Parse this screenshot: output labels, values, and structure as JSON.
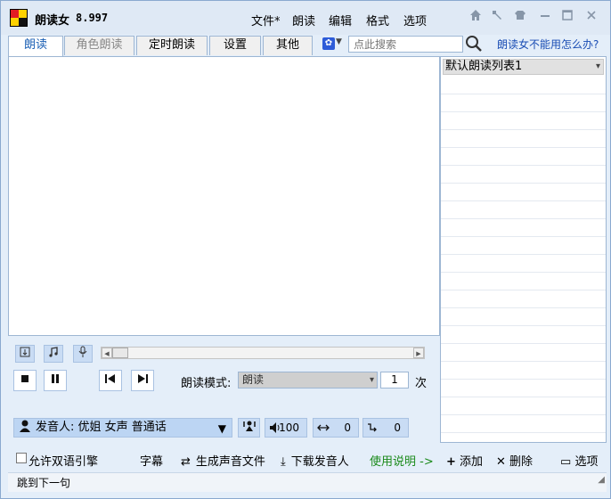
{
  "app": {
    "title": "朗读女",
    "version": "8.997"
  },
  "menu": [
    "文件*",
    "朗读",
    "编辑",
    "格式",
    "选项"
  ],
  "tabs": [
    {
      "label": "朗读",
      "active": true
    },
    {
      "label": "角色朗读",
      "disabled": true
    },
    {
      "label": "定时朗读"
    },
    {
      "label": "设置"
    },
    {
      "label": "其他"
    }
  ],
  "search": {
    "placeholder": "点此搜索"
  },
  "help_link": "朗读女不能用怎么办?",
  "reading_list": {
    "selected": "默认朗读列表1"
  },
  "player": {
    "mode_label": "朗读模式:",
    "mode_value": "朗读",
    "repeat_count": "1",
    "repeat_unit": "次"
  },
  "voice": {
    "speaker": "发音人: 优姐 女声 普通话",
    "volume": "100",
    "speed": "0",
    "pitch": "0"
  },
  "bottom": {
    "bilingual": "允许双语引擎",
    "subtitle": "字幕",
    "generate_audio": "生成声音文件",
    "download_voice": "下载发音人",
    "instructions": "使用说明 ->"
  },
  "list_actions": {
    "add": "添加",
    "delete": "删除",
    "options": "选项"
  },
  "status": "跳到下一句",
  "colors": {
    "accent": "#1a5fb4",
    "green_link": "#1a8a1a"
  }
}
